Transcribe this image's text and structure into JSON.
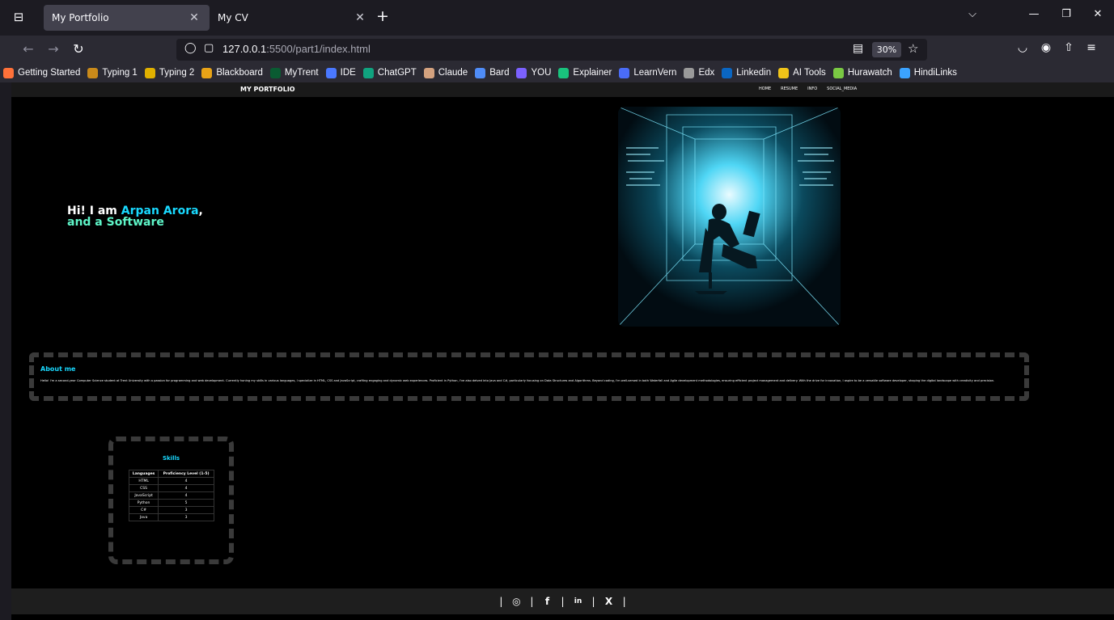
{
  "browser": {
    "tabs": [
      {
        "title": "My Portfolio",
        "active": true
      },
      {
        "title": "My CV",
        "active": false
      }
    ],
    "url": {
      "host": "127.0.0.1",
      "rest": ":5500/part1/index.html"
    },
    "zoom": "30%",
    "bookmarks": [
      {
        "label": "Getting Started",
        "icon": "firefox-icon",
        "color": "#ff7139"
      },
      {
        "label": "Typing 1",
        "icon": "hand-icon",
        "color": "#c98a1a"
      },
      {
        "label": "Typing 2",
        "icon": "mt-icon",
        "color": "#e0b000"
      },
      {
        "label": "Blackboard",
        "icon": "chart-icon",
        "color": "#e8a317"
      },
      {
        "label": "MyTrent",
        "icon": "leaf-icon",
        "color": "#0a5b32"
      },
      {
        "label": "IDE",
        "icon": "ide-icon",
        "color": "#4a78ff"
      },
      {
        "label": "ChatGPT",
        "icon": "chatgpt-icon",
        "color": "#10a37f"
      },
      {
        "label": "Claude",
        "icon": "claude-icon",
        "color": "#d4a27f"
      },
      {
        "label": "Bard",
        "icon": "sparkle-icon",
        "color": "#4f8cf7"
      },
      {
        "label": "YOU",
        "icon": "you-icon",
        "color": "#7b61ff"
      },
      {
        "label": "Explainer",
        "icon": "d-icon",
        "color": "#19c37d"
      },
      {
        "label": "LearnVern",
        "icon": "translate-icon",
        "color": "#4a6cf7"
      },
      {
        "label": "Edx",
        "icon": "edx-icon",
        "color": "#9a9a9a"
      },
      {
        "label": "Linkedin",
        "icon": "linkedin-icon",
        "color": "#0a66c2"
      },
      {
        "label": "AI Tools",
        "icon": "f-icon",
        "color": "#f0c419"
      },
      {
        "label": "Hurawatch",
        "icon": "h-icon",
        "color": "#7ac943"
      },
      {
        "label": "HindiLinks",
        "icon": "hindilinks-icon",
        "color": "#3ba3ff"
      }
    ]
  },
  "site": {
    "brand": "MY PORTFOLIO",
    "menu": [
      "HOME",
      "RESUME",
      "INFO",
      "SOCIAL_MEDIA"
    ],
    "hero": {
      "prefix": "Hi! I am ",
      "name": "Arpan Arora",
      "comma": ",",
      "line2": "and a Software"
    },
    "about": {
      "heading": "About me",
      "text": "Hello! I'm a second-year Computer Science student at Trent University with a passion for programming and web development. Currently honing my skills in various languages, I specialize in HTML, CSS and JavaScript, crafting engaging and dynamic web experiences. Proficient in Python, I've also delved into Java and C#, particularly focusing on Data Structures and Algorithms. Beyond coding, I'm well-versed in both Waterfall and Agile development methodologies, ensuring efficient project management and delivery. With the drive for innovation, I aspire to be a versatile software developer, shaping the digital landscape with creativity and precision."
    },
    "skills": {
      "heading": "Skills",
      "columns": [
        "Languages",
        "Proficiency Level (1-5)"
      ],
      "rows": [
        [
          "HTML",
          "4"
        ],
        [
          "CSS",
          "4"
        ],
        [
          "JavaScript",
          "4"
        ],
        [
          "Python",
          "5"
        ],
        [
          "C#",
          "3"
        ],
        [
          "Java",
          "3"
        ]
      ]
    },
    "footer": {
      "icons": [
        "instagram-icon",
        "facebook-icon",
        "linkedin-icon",
        "x-icon"
      ],
      "glyphs": [
        "◎",
        "f",
        "in",
        "X"
      ]
    }
  }
}
